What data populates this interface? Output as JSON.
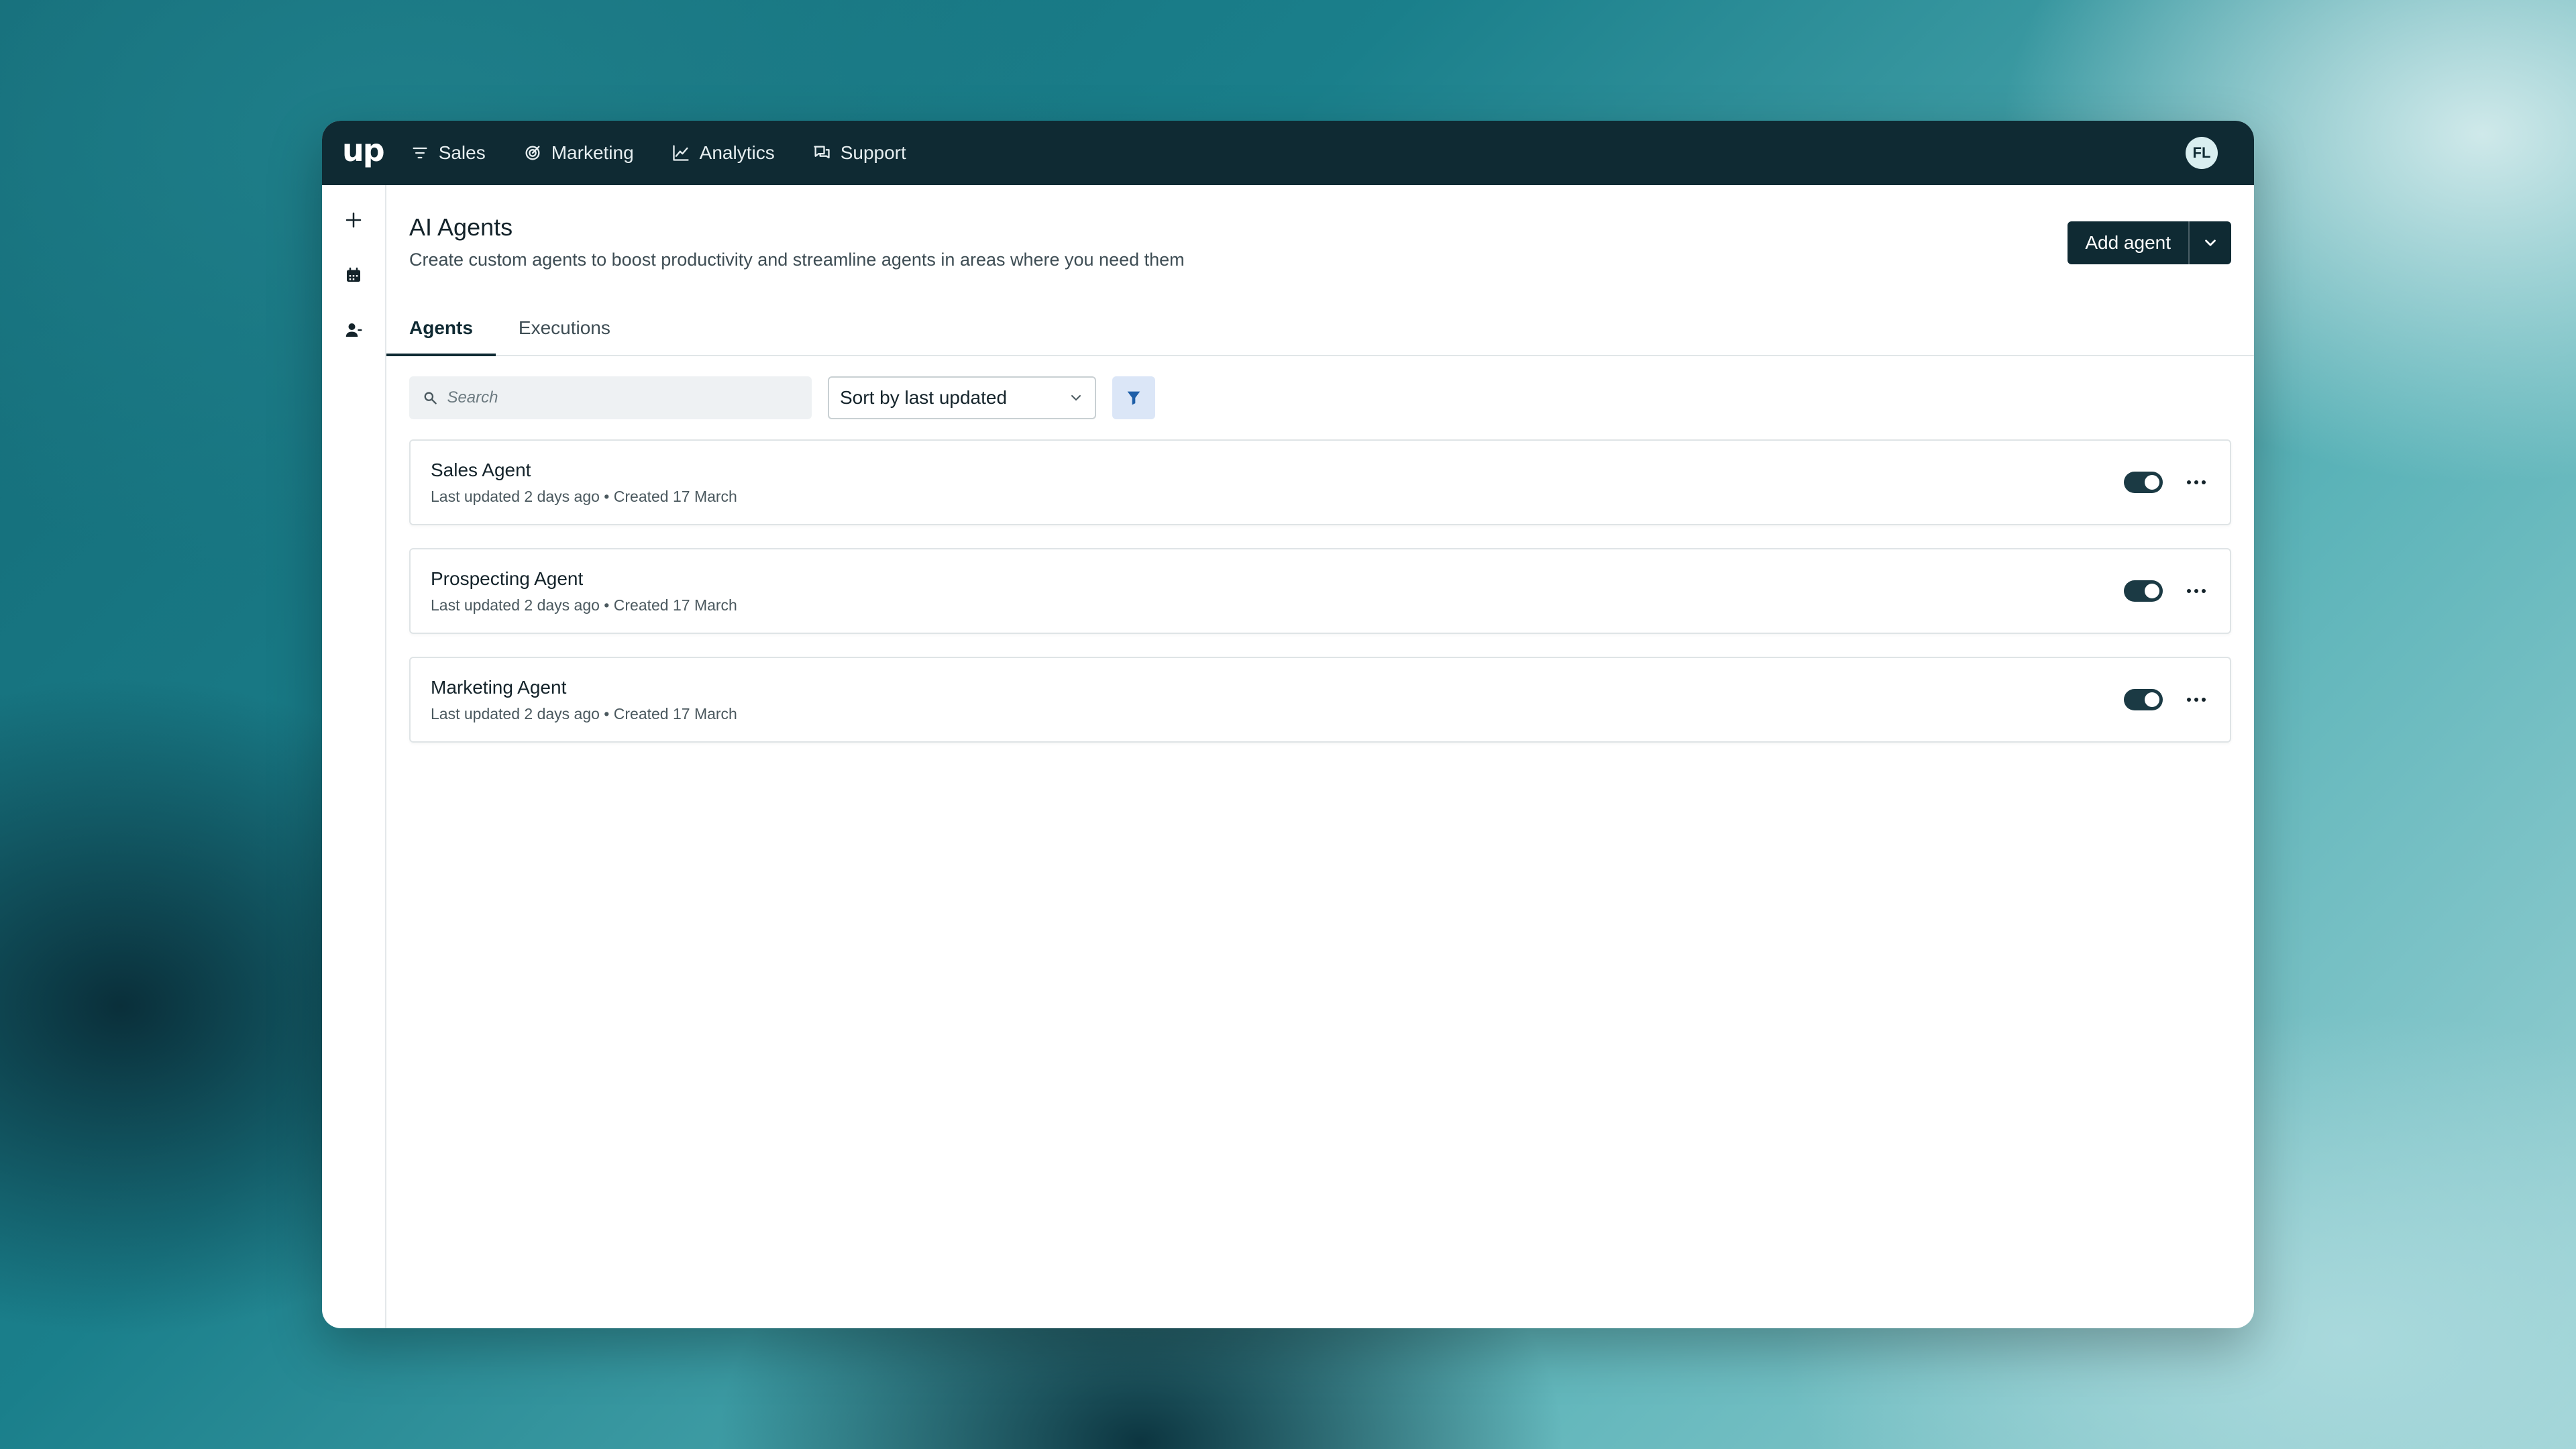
{
  "nav": {
    "logo": "up",
    "items": [
      {
        "label": "Sales",
        "icon": "filter-lines-icon"
      },
      {
        "label": "Marketing",
        "icon": "target-icon"
      },
      {
        "label": "Analytics",
        "icon": "line-chart-icon"
      },
      {
        "label": "Support",
        "icon": "chat-bubbles-icon"
      }
    ],
    "avatar_initials": "FL"
  },
  "rail": {
    "items": [
      "plus-icon",
      "calendar-icon",
      "user-icon"
    ]
  },
  "header": {
    "title": "AI Agents",
    "subtitle": "Create custom agents to boost productivity and streamline agents in areas where you need them",
    "add_label": "Add agent"
  },
  "tabs": [
    {
      "label": "Agents",
      "active": true
    },
    {
      "label": "Executions",
      "active": false
    }
  ],
  "toolbar": {
    "search_placeholder": "Search",
    "sort_label": "Sort by last updated"
  },
  "agents": [
    {
      "name": "Sales Agent",
      "meta": "Last updated 2 days ago • Created 17 March",
      "enabled": true
    },
    {
      "name": "Prospecting Agent",
      "meta": "Last updated 2 days ago • Created 17 March",
      "enabled": true
    },
    {
      "name": "Marketing Agent",
      "meta": "Last updated 2 days ago • Created 17 March",
      "enabled": true
    }
  ],
  "colors": {
    "brand_dark": "#0f2a33",
    "filter_bg": "#dbe6f7",
    "filter_icon": "#1f5fa8"
  }
}
